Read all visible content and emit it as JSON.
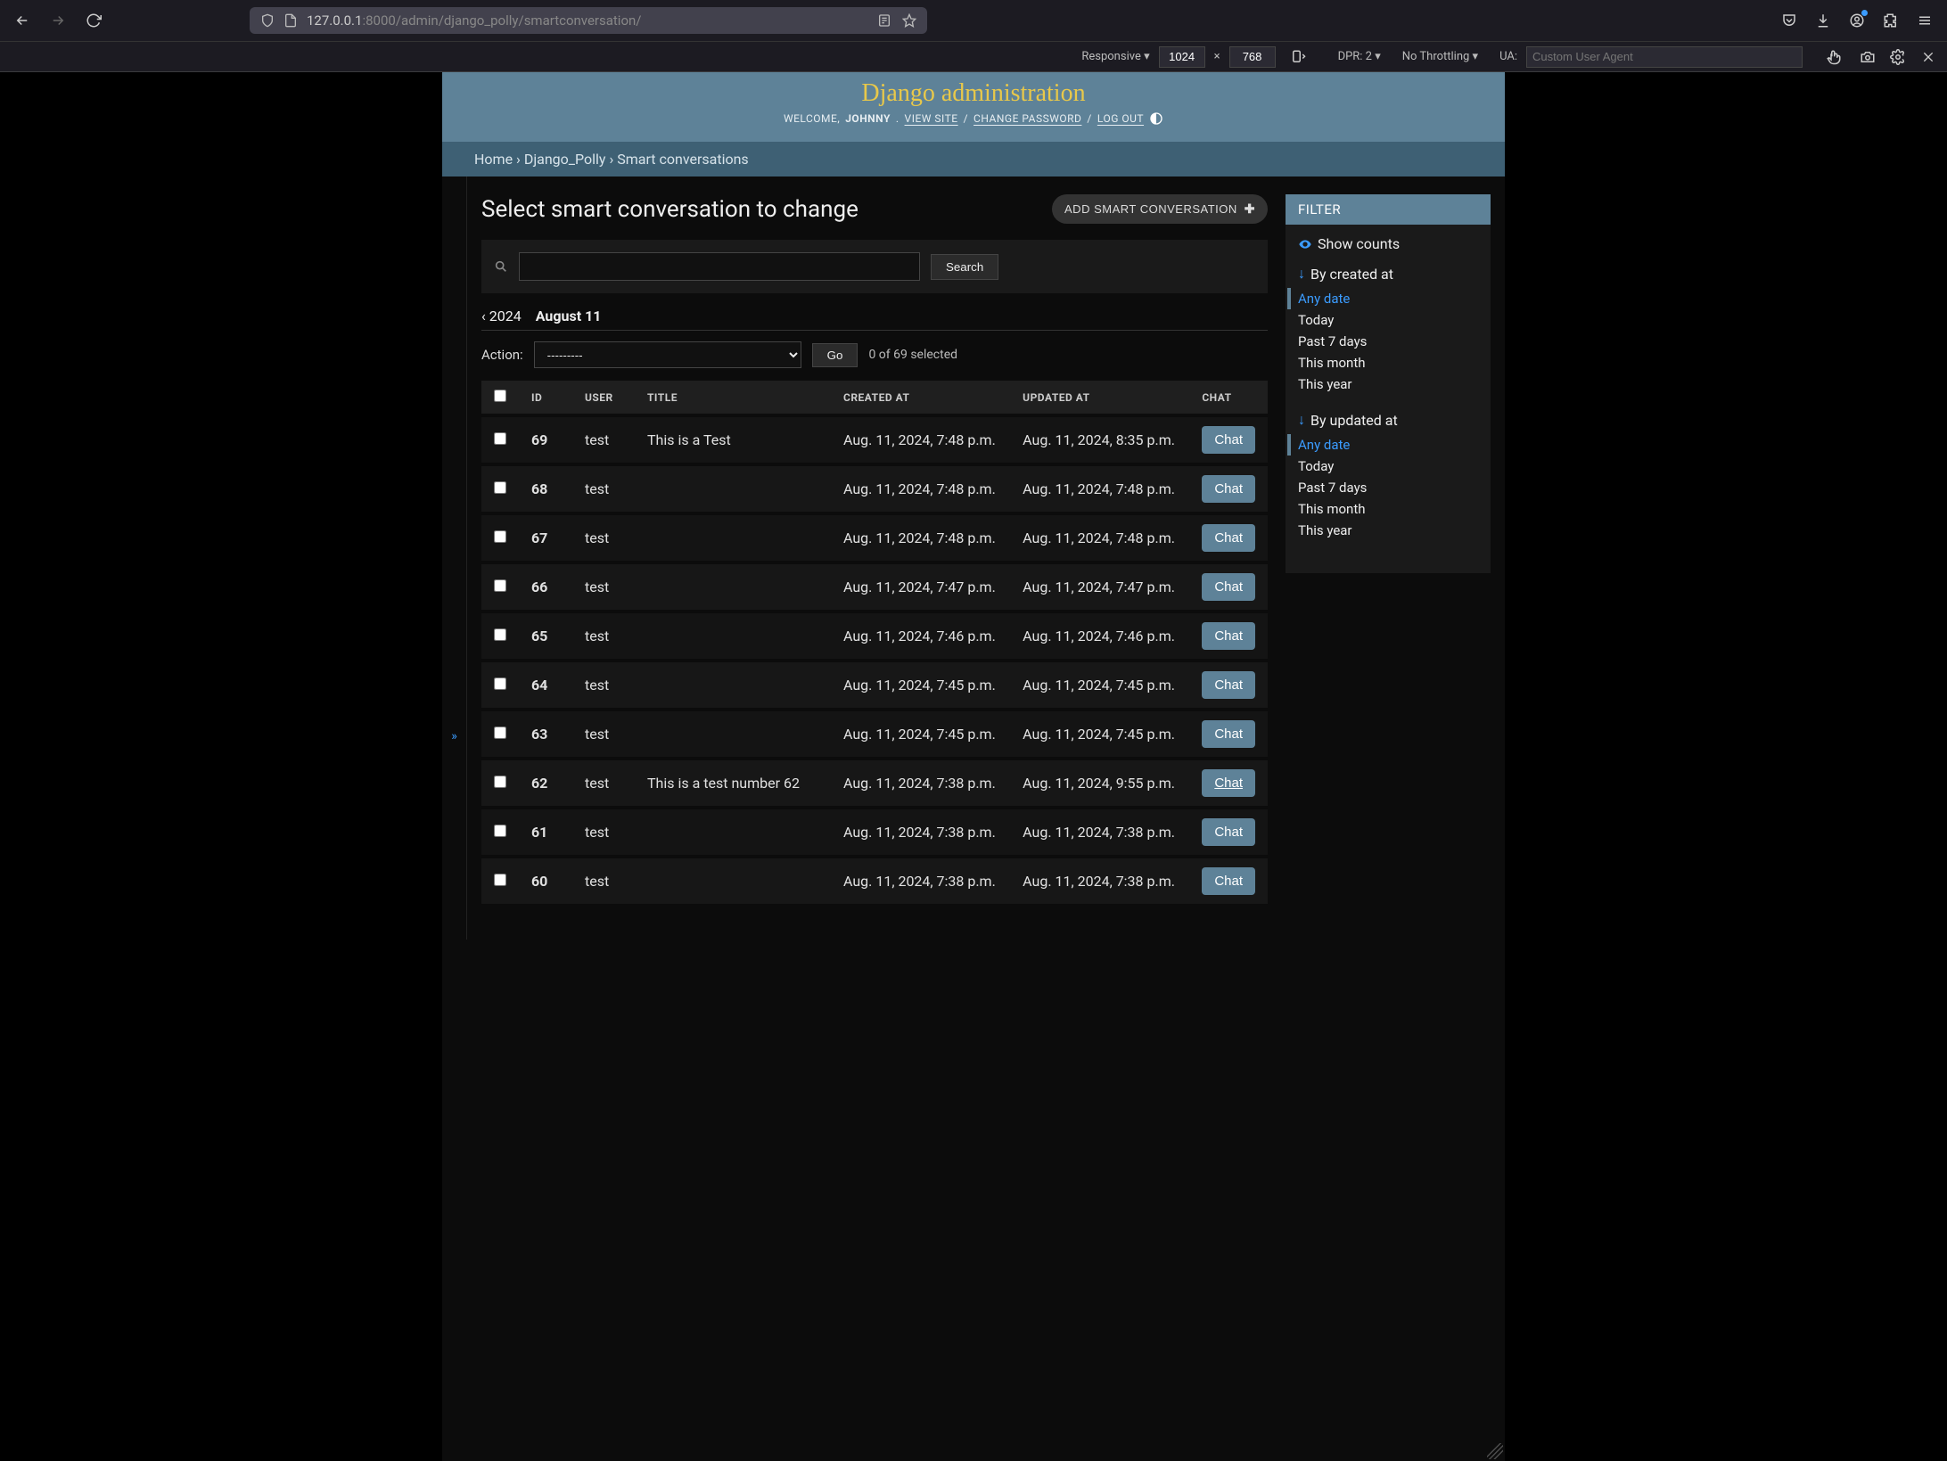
{
  "browser": {
    "url_host": "127.0.0.1",
    "url_port": ":8000",
    "url_path": "/admin/django_polly/smartconversation/"
  },
  "devtools": {
    "responsive_label": "Responsive",
    "width": "1024",
    "height": "768",
    "dpr_label": "DPR: 2",
    "throttle_label": "No Throttling",
    "ua_label": "UA:",
    "ua_placeholder": "Custom User Agent"
  },
  "header": {
    "title": "Django administration",
    "welcome": "WELCOME,",
    "username": "JOHNNY",
    "view_site": "VIEW SITE",
    "change_password": "CHANGE PASSWORD",
    "log_out": "LOG OUT"
  },
  "breadcrumbs": {
    "home": "Home",
    "app": "Django_Polly",
    "model": "Smart conversations"
  },
  "page": {
    "heading": "Select smart conversation to change",
    "add_label": "ADD SMART CONVERSATION",
    "search_label": "Search",
    "date_prev": "‹ 2024",
    "date_current": "August 11",
    "action_label": "Action:",
    "action_placeholder": "---------",
    "go_label": "Go",
    "selected_text": "0 of 69 selected"
  },
  "columns": {
    "id": "ID",
    "user": "USER",
    "title": "TITLE",
    "created_at": "CREATED AT",
    "updated_at": "UPDATED AT",
    "chat": "CHAT"
  },
  "rows": [
    {
      "id": "69",
      "user": "test",
      "title": "This is a Test",
      "created": "Aug. 11, 2024, 7:48 p.m.",
      "updated": "Aug. 11, 2024, 8:35 p.m.",
      "chat": "Chat",
      "chat_underline": false
    },
    {
      "id": "68",
      "user": "test",
      "title": "",
      "created": "Aug. 11, 2024, 7:48 p.m.",
      "updated": "Aug. 11, 2024, 7:48 p.m.",
      "chat": "Chat",
      "chat_underline": false
    },
    {
      "id": "67",
      "user": "test",
      "title": "",
      "created": "Aug. 11, 2024, 7:48 p.m.",
      "updated": "Aug. 11, 2024, 7:48 p.m.",
      "chat": "Chat",
      "chat_underline": false
    },
    {
      "id": "66",
      "user": "test",
      "title": "",
      "created": "Aug. 11, 2024, 7:47 p.m.",
      "updated": "Aug. 11, 2024, 7:47 p.m.",
      "chat": "Chat",
      "chat_underline": false
    },
    {
      "id": "65",
      "user": "test",
      "title": "",
      "created": "Aug. 11, 2024, 7:46 p.m.",
      "updated": "Aug. 11, 2024, 7:46 p.m.",
      "chat": "Chat",
      "chat_underline": false
    },
    {
      "id": "64",
      "user": "test",
      "title": "",
      "created": "Aug. 11, 2024, 7:45 p.m.",
      "updated": "Aug. 11, 2024, 7:45 p.m.",
      "chat": "Chat",
      "chat_underline": false
    },
    {
      "id": "63",
      "user": "test",
      "title": "",
      "created": "Aug. 11, 2024, 7:45 p.m.",
      "updated": "Aug. 11, 2024, 7:45 p.m.",
      "chat": "Chat",
      "chat_underline": false
    },
    {
      "id": "62",
      "user": "test",
      "title": "This is a test number 62",
      "created": "Aug. 11, 2024, 7:38 p.m.",
      "updated": "Aug. 11, 2024, 9:55 p.m.",
      "chat": "Chat",
      "chat_underline": true
    },
    {
      "id": "61",
      "user": "test",
      "title": "",
      "created": "Aug. 11, 2024, 7:38 p.m.",
      "updated": "Aug. 11, 2024, 7:38 p.m.",
      "chat": "Chat",
      "chat_underline": false
    },
    {
      "id": "60",
      "user": "test",
      "title": "",
      "created": "Aug. 11, 2024, 7:38 p.m.",
      "updated": "Aug. 11, 2024, 7:38 p.m.",
      "chat": "Chat",
      "chat_underline": false
    }
  ],
  "filter": {
    "title": "FILTER",
    "show_counts": "Show counts",
    "groups": [
      {
        "label": "By created at",
        "active": "Any date",
        "options": [
          "Any date",
          "Today",
          "Past 7 days",
          "This month",
          "This year"
        ]
      },
      {
        "label": "By updated at",
        "active": "Any date",
        "options": [
          "Any date",
          "Today",
          "Past 7 days",
          "This month",
          "This year"
        ]
      }
    ]
  }
}
